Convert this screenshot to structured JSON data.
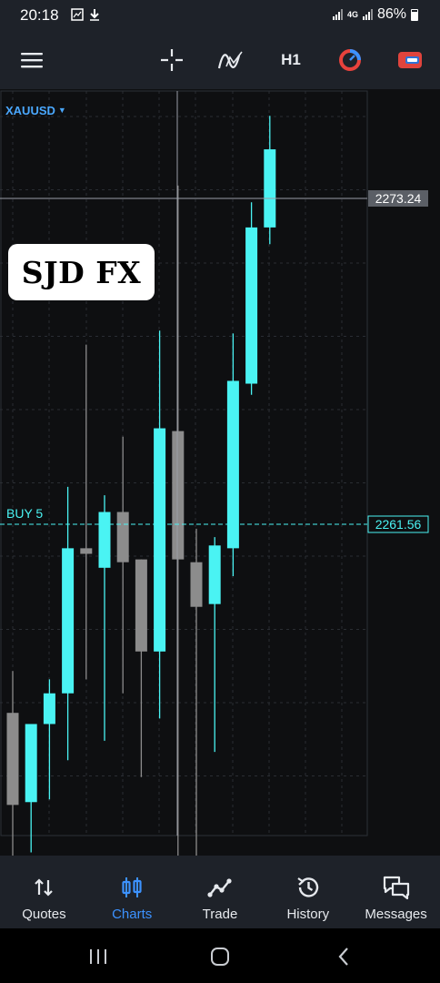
{
  "status_bar": {
    "time": "20:18",
    "network": "4G",
    "battery": "86%"
  },
  "toolbar": {
    "timeframe": "H1",
    "icons": [
      "menu-icon",
      "crosshair-icon",
      "indicators-icon",
      "timeframe",
      "chart-type-icon",
      "trade-toggle-icon"
    ]
  },
  "chart": {
    "symbol": "XAUUSD",
    "crosshair_price": "2273.24",
    "position_label": "BUY 5",
    "position_price": "2261.56",
    "watermark": "SJD FX",
    "colors": {
      "bull": "#4af3f3",
      "bear": "#8c8c8c",
      "background": "#0e0f11",
      "grid": "#2a2d33"
    }
  },
  "chart_data": {
    "type": "candlestick",
    "timeframe": "H1",
    "symbol": "XAUUSD",
    "price_markers": [
      {
        "label": "BUY 5",
        "price": 2261.56
      },
      {
        "label": "crosshair",
        "price": 2273.24
      }
    ],
    "candles": [
      {
        "open": 2254.8,
        "high": 2256.3,
        "low": 2249.5,
        "close": 2251.5
      },
      {
        "open": 2251.6,
        "high": 2254.2,
        "low": 2249.8,
        "close": 2254.4
      },
      {
        "open": 2254.4,
        "high": 2256.0,
        "low": 2251.7,
        "close": 2255.5
      },
      {
        "open": 2255.5,
        "high": 2262.9,
        "low": 2253.1,
        "close": 2260.7
      },
      {
        "open": 2260.7,
        "high": 2268.0,
        "low": 2256.0,
        "close": 2260.5
      },
      {
        "open": 2260.0,
        "high": 2262.6,
        "low": 2253.8,
        "close": 2262.0
      },
      {
        "open": 2262.0,
        "high": 2264.7,
        "low": 2255.5,
        "close": 2260.2
      },
      {
        "open": 2260.3,
        "high": 2259.9,
        "low": 2252.5,
        "close": 2257.0
      },
      {
        "open": 2257.0,
        "high": 2268.5,
        "low": 2254.6,
        "close": 2265.0
      },
      {
        "open": 2264.9,
        "high": 2273.7,
        "low": 2249.3,
        "close": 2260.3
      },
      {
        "open": 2260.2,
        "high": 2261.4,
        "low": 2248.5,
        "close": 2258.6
      },
      {
        "open": 2258.7,
        "high": 2261.1,
        "low": 2253.4,
        "close": 2260.8
      },
      {
        "open": 2260.7,
        "high": 2268.4,
        "low": 2259.7,
        "close": 2266.7
      },
      {
        "open": 2266.6,
        "high": 2273.1,
        "low": 2266.2,
        "close": 2272.2
      },
      {
        "open": 2272.2,
        "high": 2276.2,
        "low": 2271.6,
        "close": 2275.0
      }
    ]
  },
  "nav": {
    "items": [
      {
        "label": "Quotes"
      },
      {
        "label": "Charts"
      },
      {
        "label": "Trade"
      },
      {
        "label": "History"
      },
      {
        "label": "Messages"
      }
    ]
  }
}
